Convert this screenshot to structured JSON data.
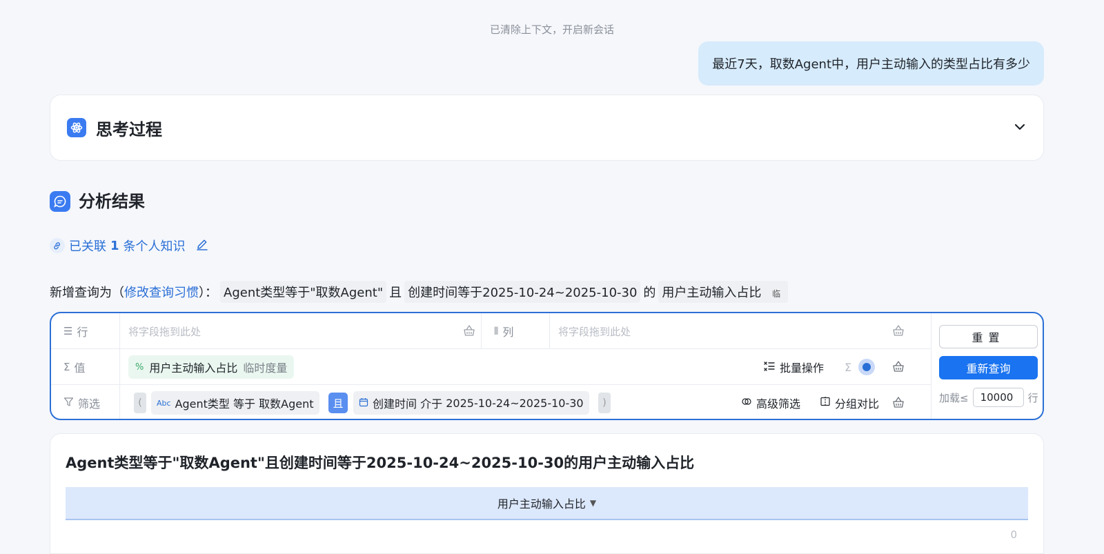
{
  "system_note": "已清除上下文，开启新会话",
  "user_message": "最近7天，取数Agent中，用户主动输入的类型占比有多少",
  "thinking": {
    "title": "思考过程"
  },
  "analysis": {
    "title": "分析结果"
  },
  "knowledge": {
    "prefix": "已关联",
    "count": "1",
    "suffix": "条个人知识"
  },
  "query_line": {
    "prefix": "新增查询为（",
    "link": "修改查询习惯",
    "suffix": "）：",
    "cond1": "Agent类型等于\"取数Agent\"",
    "and1": "且",
    "cond2": "创建时间等于2025-10-24~2025-10-30",
    "of": "的",
    "measure": "用户主动输入占比",
    "tag": "临"
  },
  "builder": {
    "row_label": "行",
    "col_label": "列",
    "value_label": "值",
    "filter_label": "筛选",
    "row_placeholder": "将字段拖到此处",
    "col_placeholder": "将字段拖到此处",
    "value_chip": {
      "name": "用户主动输入占比",
      "sub": "临时度量"
    },
    "batch_label": "批量操作",
    "filter1": {
      "field": "Agent类型",
      "op": "等于",
      "value": "取数Agent"
    },
    "and_label": "且",
    "filter2": {
      "field": "创建时间",
      "op": "介于",
      "value": "2025-10-24~2025-10-30"
    },
    "advanced_filter": "高级筛选",
    "group_compare": "分组对比",
    "reset": "重置",
    "requery": "重新查询",
    "load_prefix": "加载≤",
    "load_value": "10000",
    "load_suffix": "行"
  },
  "result": {
    "title": "Agent类型等于\"取数Agent\"且创建时间等于2025-10-24~2025-10-30的用户主动输入占比",
    "column": "用户主动输入占比",
    "value": "0"
  }
}
